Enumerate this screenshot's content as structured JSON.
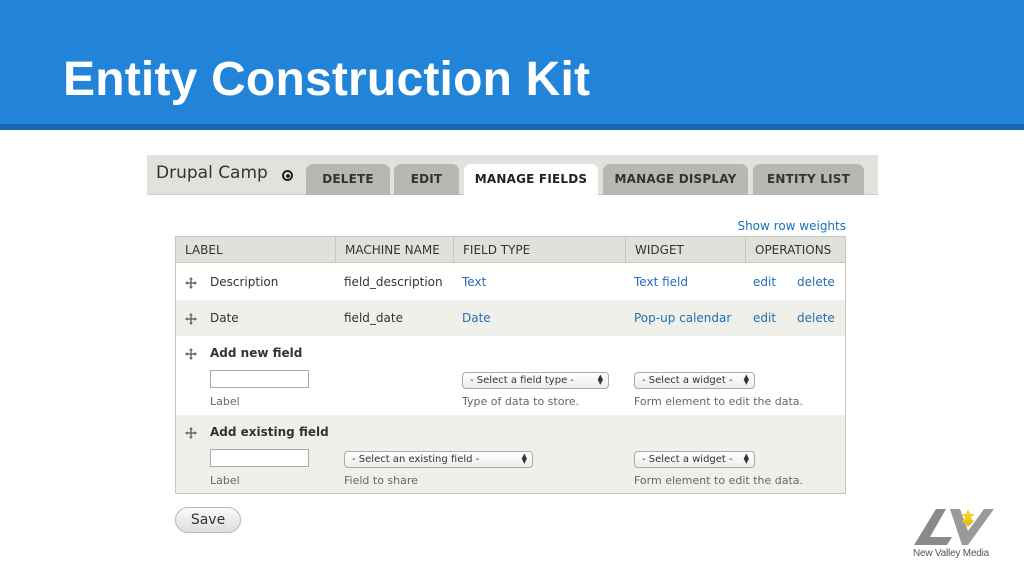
{
  "slide": {
    "title": "Entity Construction Kit",
    "header_color": "#2284d8"
  },
  "drupal": {
    "site_name": "Drupal Camp",
    "add_icon": "plus-circle-icon",
    "tabs": [
      {
        "label": "DELETE",
        "active": false
      },
      {
        "label": "EDIT",
        "active": false
      },
      {
        "label": "MANAGE FIELDS",
        "active": true
      },
      {
        "label": "MANAGE DISPLAY",
        "active": false
      },
      {
        "label": "ENTITY LIST",
        "active": false
      }
    ],
    "show_row_weights": "Show row weights",
    "table": {
      "headers": [
        "LABEL",
        "MACHINE NAME",
        "FIELD TYPE",
        "WIDGET",
        "OPERATIONS"
      ],
      "rows": [
        {
          "label": "Description",
          "machine_name": "field_description",
          "field_type": "Text",
          "widget": "Text field",
          "edit": "edit",
          "delete": "delete"
        },
        {
          "label": "Date",
          "machine_name": "field_date",
          "field_type": "Date",
          "widget": "Pop-up calendar",
          "edit": "edit",
          "delete": "delete"
        }
      ],
      "add_new": {
        "title": "Add new field",
        "label_value": "",
        "label_help": "Label",
        "field_type_select": "- Select a field type -",
        "field_type_help": "Type of data to store.",
        "widget_select": "- Select a widget -",
        "widget_help": "Form element to edit the data."
      },
      "add_existing": {
        "title": "Add existing field",
        "label_value": "",
        "label_help": "Label",
        "existing_select": "- Select an existing field -",
        "existing_help": "Field to share",
        "widget_select": "- Select a widget -",
        "widget_help": "Form element to edit the data."
      }
    },
    "save_label": "Save",
    "drag_icon": "move-handle-icon",
    "link_color": "#1d6fb8"
  },
  "logo": {
    "text": "New Valley Media",
    "icon": "new-valley-media-logo"
  }
}
